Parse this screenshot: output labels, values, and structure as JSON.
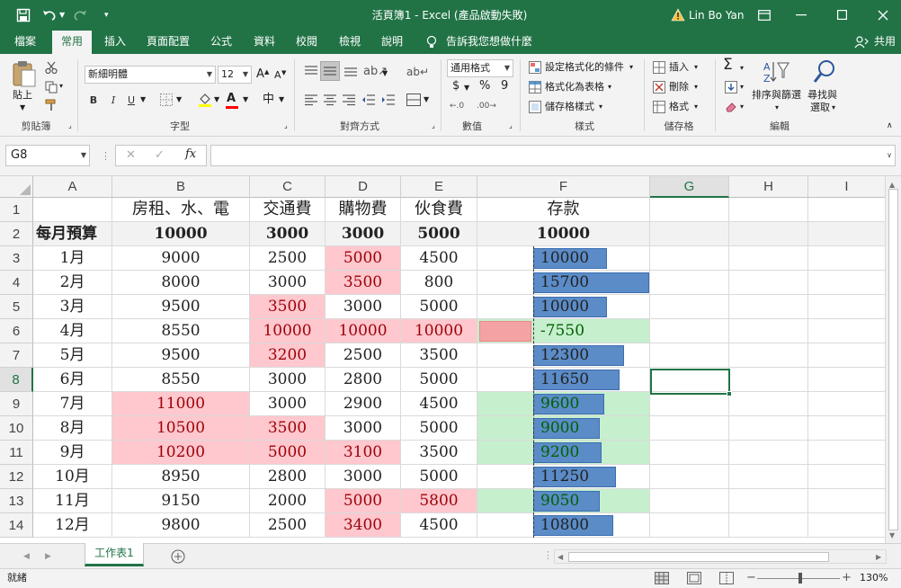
{
  "titlebar": {
    "title": "活頁簿1  -  Excel (產品啟動失敗)",
    "user": "Lin Bo Yan",
    "warning_icon": "warning-icon",
    "controls": [
      "ribbon-display-icon",
      "minimize-icon",
      "maximize-icon",
      "close-icon"
    ]
  },
  "tabs": [
    "檔案",
    "常用",
    "插入",
    "頁面配置",
    "公式",
    "資料",
    "校閱",
    "檢視",
    "說明"
  ],
  "active_tab": "常用",
  "tell_me": "告訴我您想做什麼",
  "share": "共用",
  "ribbon": {
    "clipboard": {
      "paste": "貼上",
      "label": "剪貼簿"
    },
    "font": {
      "name": "新細明體",
      "size": "12",
      "label": "字型",
      "bold": "B",
      "italic": "I",
      "underline": "U",
      "font_color": "#ff0000",
      "grow": "A",
      "shrink": "A",
      "phonetic": "中"
    },
    "alignment": {
      "label": "對齊方式"
    },
    "number": {
      "format": "通用格式",
      "currency": "$",
      "percent": "%",
      "comma": "9",
      "label": "數值"
    },
    "styles": {
      "conditional": "設定格式化的條件",
      "as_table": "格式化為表格",
      "cell_styles": "儲存格樣式",
      "label": "樣式"
    },
    "cells": {
      "insert": "插入",
      "delete": "刪除",
      "format": "格式",
      "label": "儲存格"
    },
    "editing": {
      "autosum": "Σ",
      "sort": "排序與篩選",
      "find_line1": "尋找與",
      "find_line2": "選取",
      "label": "編輯"
    }
  },
  "formula_bar": {
    "name_box": "G8",
    "fx": "fx",
    "cancel": "✕",
    "enter": "✓",
    "formula": ""
  },
  "columns": [
    "A",
    "B",
    "C",
    "D",
    "E",
    "F",
    "G",
    "H",
    "I"
  ],
  "selected_column": "G",
  "selected_row": 8,
  "rows": [
    {
      "num": 1,
      "cells": [
        "",
        "房租、水、電",
        "交通費",
        "購物費",
        "伙食費",
        "存款"
      ]
    },
    {
      "num": 2,
      "cells": [
        "每月預算",
        "10000",
        "3000",
        "3000",
        "5000",
        "10000"
      ]
    },
    {
      "num": 3,
      "cells": [
        "1月",
        "9000",
        "2500",
        "5000",
        "4500",
        "10000"
      ]
    },
    {
      "num": 4,
      "cells": [
        "2月",
        "8000",
        "3000",
        "3500",
        "800",
        "15700"
      ]
    },
    {
      "num": 5,
      "cells": [
        "3月",
        "9500",
        "3500",
        "3000",
        "5000",
        "10000"
      ]
    },
    {
      "num": 6,
      "cells": [
        "4月",
        "8550",
        "10000",
        "10000",
        "10000",
        "-7550"
      ]
    },
    {
      "num": 7,
      "cells": [
        "5月",
        "9500",
        "3200",
        "2500",
        "3500",
        "12300"
      ]
    },
    {
      "num": 8,
      "cells": [
        "6月",
        "8550",
        "3000",
        "2800",
        "5000",
        "11650"
      ]
    },
    {
      "num": 9,
      "cells": [
        "7月",
        "11000",
        "3000",
        "2900",
        "4500",
        "9600"
      ]
    },
    {
      "num": 10,
      "cells": [
        "8月",
        "10500",
        "3500",
        "3000",
        "5000",
        "9000"
      ]
    },
    {
      "num": 11,
      "cells": [
        "9月",
        "10200",
        "5000",
        "3100",
        "3500",
        "9200"
      ]
    },
    {
      "num": 12,
      "cells": [
        "10月",
        "8950",
        "2800",
        "3000",
        "5000",
        "11250"
      ]
    },
    {
      "num": 13,
      "cells": [
        "11月",
        "9150",
        "2000",
        "5000",
        "5800",
        "9050"
      ]
    },
    {
      "num": 14,
      "cells": [
        "12月",
        "9800",
        "2500",
        "3400",
        "4500",
        "10800"
      ]
    }
  ],
  "highlight": {
    "pink_color": "#ffc7ce",
    "green_color": "#c6efce",
    "databar_color": "#5b8cc8",
    "databar_max": 15700
  },
  "sheet_tab": "工作表1",
  "status": {
    "ready": "就緒",
    "zoom": "130%"
  }
}
